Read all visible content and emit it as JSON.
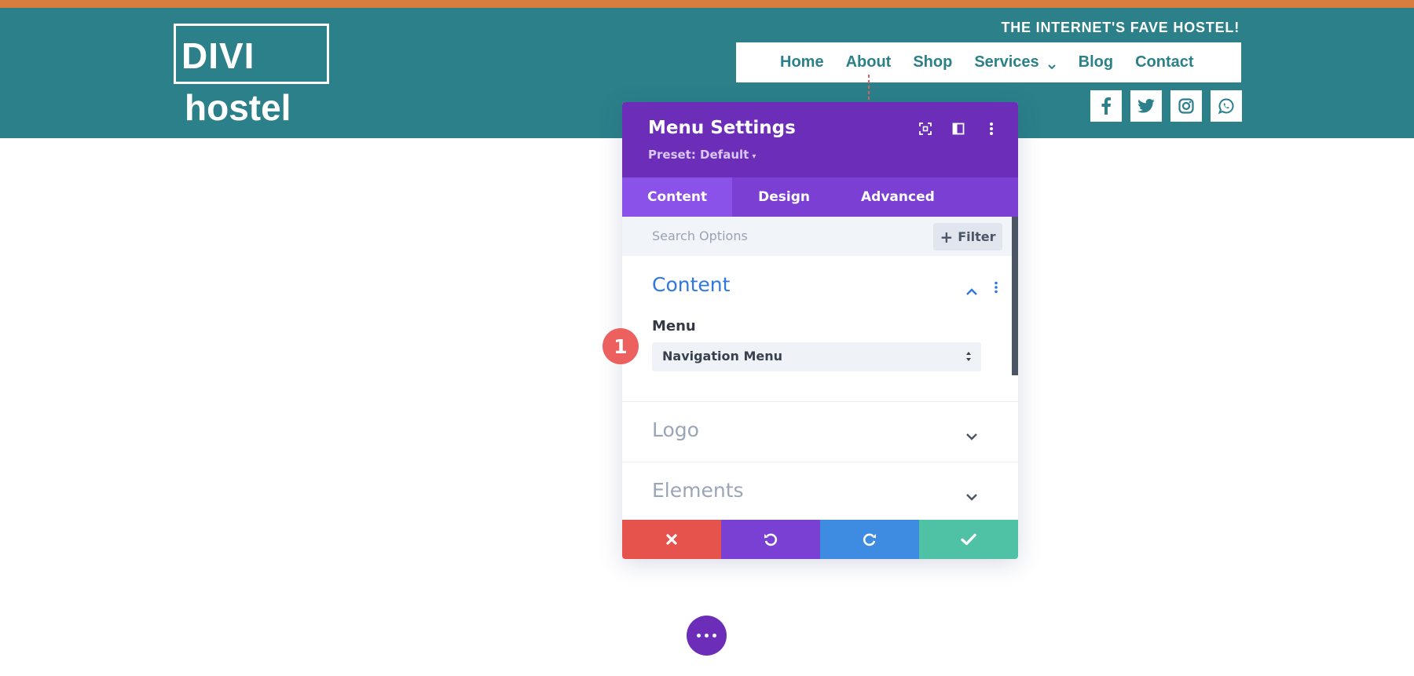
{
  "site": {
    "logo_line1": "DIVI",
    "logo_line2": "hostel",
    "tagline": "THE INTERNET'S FAVE HOSTEL!",
    "nav": [
      "Home",
      "About",
      "Shop",
      "Services",
      "Blog",
      "Contact"
    ],
    "social_icons": [
      "facebook-icon",
      "twitter-icon",
      "instagram-icon",
      "whatsapp-icon"
    ]
  },
  "panel": {
    "title": "Menu Settings",
    "preset": "Preset: Default",
    "tabs": [
      "Content",
      "Design",
      "Advanced"
    ],
    "active_tab": "Content",
    "search_placeholder": "Search Options",
    "filter_label": "Filter",
    "sections": {
      "content": {
        "title": "Content",
        "field_label": "Menu",
        "select_value": "Navigation Menu"
      },
      "logo": {
        "title": "Logo"
      },
      "elements": {
        "title": "Elements"
      }
    },
    "footer_buttons": [
      "cancel-icon",
      "undo-icon",
      "redo-icon",
      "save-icon"
    ]
  },
  "annotation": {
    "badge": "1"
  },
  "colors": {
    "header_bg": "#2b8089",
    "top_stripe": "#d97d3f",
    "panel_header": "#6c2eb9",
    "tabs_bg": "#7b40d3",
    "active_tab": "#8b52ea",
    "section_title_active": "#2f78de",
    "cancel": "#e6534d",
    "undo": "#7a3fd3",
    "redo": "#3d8ce1",
    "save": "#4fc2a6",
    "badge": "#ec6060"
  }
}
